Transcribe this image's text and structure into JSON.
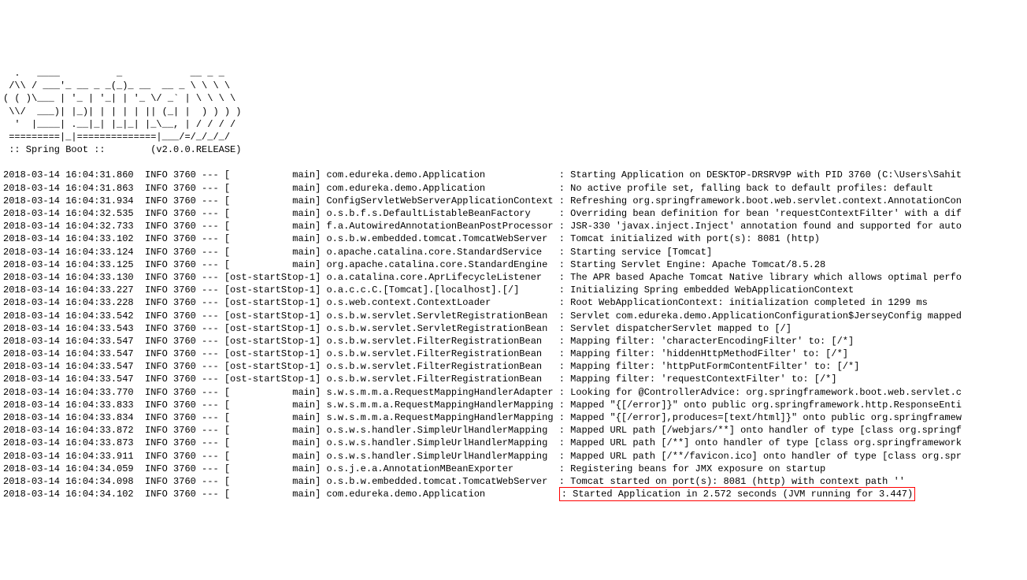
{
  "banner": {
    "l1": "  .   ____          _            __ _ _",
    "l2": " /\\\\ / ___'_ __ _ _(_)_ __  __ _ \\ \\ \\ \\",
    "l3": "( ( )\\___ | '_ | '_| | '_ \\/ _` | \\ \\ \\ \\",
    "l4": " \\\\/  ___)| |_)| | | | | || (_| |  ) ) ) )",
    "l5": "  '  |____| .__|_| |_|_| |_\\__, | / / / /",
    "l6": " =========|_|==============|___/=/_/_/_/",
    "l7": " :: Spring Boot ::        (v2.0.0.RELEASE)"
  },
  "logs": [
    {
      "ts": "2018-03-14 16:04:31.860",
      "lvl": "INFO",
      "pid": "3760",
      "sep": "---",
      "thread": "[           main]",
      "logger": "com.edureka.demo.Application            ",
      "msg": ": Starting Application on DESKTOP-DRSRV9P with PID 3760 (C:\\Users\\Sahit"
    },
    {
      "ts": "2018-03-14 16:04:31.863",
      "lvl": "INFO",
      "pid": "3760",
      "sep": "---",
      "thread": "[           main]",
      "logger": "com.edureka.demo.Application            ",
      "msg": ": No active profile set, falling back to default profiles: default"
    },
    {
      "ts": "2018-03-14 16:04:31.934",
      "lvl": "INFO",
      "pid": "3760",
      "sep": "---",
      "thread": "[           main]",
      "logger": "ConfigServletWebServerApplicationContext",
      "msg": ": Refreshing org.springframework.boot.web.servlet.context.AnnotationCon"
    },
    {
      "ts": "2018-03-14 16:04:32.535",
      "lvl": "INFO",
      "pid": "3760",
      "sep": "---",
      "thread": "[           main]",
      "logger": "o.s.b.f.s.DefaultListableBeanFactory    ",
      "msg": ": Overriding bean definition for bean 'requestContextFilter' with a dif"
    },
    {
      "ts": "2018-03-14 16:04:32.733",
      "lvl": "INFO",
      "pid": "3760",
      "sep": "---",
      "thread": "[           main]",
      "logger": "f.a.AutowiredAnnotationBeanPostProcessor",
      "msg": ": JSR-330 'javax.inject.Inject' annotation found and supported for auto"
    },
    {
      "ts": "2018-03-14 16:04:33.102",
      "lvl": "INFO",
      "pid": "3760",
      "sep": "---",
      "thread": "[           main]",
      "logger": "o.s.b.w.embedded.tomcat.TomcatWebServer ",
      "msg": ": Tomcat initialized with port(s): 8081 (http)"
    },
    {
      "ts": "2018-03-14 16:04:33.124",
      "lvl": "INFO",
      "pid": "3760",
      "sep": "---",
      "thread": "[           main]",
      "logger": "o.apache.catalina.core.StandardService  ",
      "msg": ": Starting service [Tomcat]"
    },
    {
      "ts": "2018-03-14 16:04:33.125",
      "lvl": "INFO",
      "pid": "3760",
      "sep": "---",
      "thread": "[           main]",
      "logger": "org.apache.catalina.core.StandardEngine ",
      "msg": ": Starting Servlet Engine: Apache Tomcat/8.5.28"
    },
    {
      "ts": "2018-03-14 16:04:33.130",
      "lvl": "INFO",
      "pid": "3760",
      "sep": "---",
      "thread": "[ost-startStop-1]",
      "logger": "o.a.catalina.core.AprLifecycleListener  ",
      "msg": ": The APR based Apache Tomcat Native library which allows optimal perfo"
    },
    {
      "ts": "2018-03-14 16:04:33.227",
      "lvl": "INFO",
      "pid": "3760",
      "sep": "---",
      "thread": "[ost-startStop-1]",
      "logger": "o.a.c.c.C.[Tomcat].[localhost].[/]      ",
      "msg": ": Initializing Spring embedded WebApplicationContext"
    },
    {
      "ts": "2018-03-14 16:04:33.228",
      "lvl": "INFO",
      "pid": "3760",
      "sep": "---",
      "thread": "[ost-startStop-1]",
      "logger": "o.s.web.context.ContextLoader           ",
      "msg": ": Root WebApplicationContext: initialization completed in 1299 ms"
    },
    {
      "ts": "2018-03-14 16:04:33.542",
      "lvl": "INFO",
      "pid": "3760",
      "sep": "---",
      "thread": "[ost-startStop-1]",
      "logger": "o.s.b.w.servlet.ServletRegistrationBean ",
      "msg": ": Servlet com.edureka.demo.ApplicationConfiguration$JerseyConfig mapped"
    },
    {
      "ts": "2018-03-14 16:04:33.543",
      "lvl": "INFO",
      "pid": "3760",
      "sep": "---",
      "thread": "[ost-startStop-1]",
      "logger": "o.s.b.w.servlet.ServletRegistrationBean ",
      "msg": ": Servlet dispatcherServlet mapped to [/]"
    },
    {
      "ts": "2018-03-14 16:04:33.547",
      "lvl": "INFO",
      "pid": "3760",
      "sep": "---",
      "thread": "[ost-startStop-1]",
      "logger": "o.s.b.w.servlet.FilterRegistrationBean  ",
      "msg": ": Mapping filter: 'characterEncodingFilter' to: [/*]"
    },
    {
      "ts": "2018-03-14 16:04:33.547",
      "lvl": "INFO",
      "pid": "3760",
      "sep": "---",
      "thread": "[ost-startStop-1]",
      "logger": "o.s.b.w.servlet.FilterRegistrationBean  ",
      "msg": ": Mapping filter: 'hiddenHttpMethodFilter' to: [/*]"
    },
    {
      "ts": "2018-03-14 16:04:33.547",
      "lvl": "INFO",
      "pid": "3760",
      "sep": "---",
      "thread": "[ost-startStop-1]",
      "logger": "o.s.b.w.servlet.FilterRegistrationBean  ",
      "msg": ": Mapping filter: 'httpPutFormContentFilter' to: [/*]"
    },
    {
      "ts": "2018-03-14 16:04:33.547",
      "lvl": "INFO",
      "pid": "3760",
      "sep": "---",
      "thread": "[ost-startStop-1]",
      "logger": "o.s.b.w.servlet.FilterRegistrationBean  ",
      "msg": ": Mapping filter: 'requestContextFilter' to: [/*]"
    },
    {
      "ts": "2018-03-14 16:04:33.770",
      "lvl": "INFO",
      "pid": "3760",
      "sep": "---",
      "thread": "[           main]",
      "logger": "s.w.s.m.m.a.RequestMappingHandlerAdapter",
      "msg": ": Looking for @ControllerAdvice: org.springframework.boot.web.servlet.c"
    },
    {
      "ts": "2018-03-14 16:04:33.833",
      "lvl": "INFO",
      "pid": "3760",
      "sep": "---",
      "thread": "[           main]",
      "logger": "s.w.s.m.m.a.RequestMappingHandlerMapping",
      "msg": ": Mapped \"{[/error]}\" onto public org.springframework.http.ResponseEnti"
    },
    {
      "ts": "2018-03-14 16:04:33.834",
      "lvl": "INFO",
      "pid": "3760",
      "sep": "---",
      "thread": "[           main]",
      "logger": "s.w.s.m.m.a.RequestMappingHandlerMapping",
      "msg": ": Mapped \"{[/error],produces=[text/html]}\" onto public org.springframew"
    },
    {
      "ts": "2018-03-14 16:04:33.872",
      "lvl": "INFO",
      "pid": "3760",
      "sep": "---",
      "thread": "[           main]",
      "logger": "o.s.w.s.handler.SimpleUrlHandlerMapping ",
      "msg": ": Mapped URL path [/webjars/**] onto handler of type [class org.springf"
    },
    {
      "ts": "2018-03-14 16:04:33.873",
      "lvl": "INFO",
      "pid": "3760",
      "sep": "---",
      "thread": "[           main]",
      "logger": "o.s.w.s.handler.SimpleUrlHandlerMapping ",
      "msg": ": Mapped URL path [/**] onto handler of type [class org.springframework"
    },
    {
      "ts": "2018-03-14 16:04:33.911",
      "lvl": "INFO",
      "pid": "3760",
      "sep": "---",
      "thread": "[           main]",
      "logger": "o.s.w.s.handler.SimpleUrlHandlerMapping ",
      "msg": ": Mapped URL path [/**/favicon.ico] onto handler of type [class org.spr"
    },
    {
      "ts": "2018-03-14 16:04:34.059",
      "lvl": "INFO",
      "pid": "3760",
      "sep": "---",
      "thread": "[           main]",
      "logger": "o.s.j.e.a.AnnotationMBeanExporter       ",
      "msg": ": Registering beans for JMX exposure on startup"
    },
    {
      "ts": "2018-03-14 16:04:34.098",
      "lvl": "INFO",
      "pid": "3760",
      "sep": "---",
      "thread": "[           main]",
      "logger": "o.s.b.w.embedded.tomcat.TomcatWebServer ",
      "msg": ": Tomcat started on port(s): 8081 (http) with context path ''"
    },
    {
      "ts": "2018-03-14 16:04:34.102",
      "lvl": "INFO",
      "pid": "3760",
      "sep": "---",
      "thread": "[           main]",
      "logger": "com.edureka.demo.Application            ",
      "msg": ": Started Application in 2.572 seconds (JVM running for 3.447)",
      "highlight": true
    }
  ]
}
